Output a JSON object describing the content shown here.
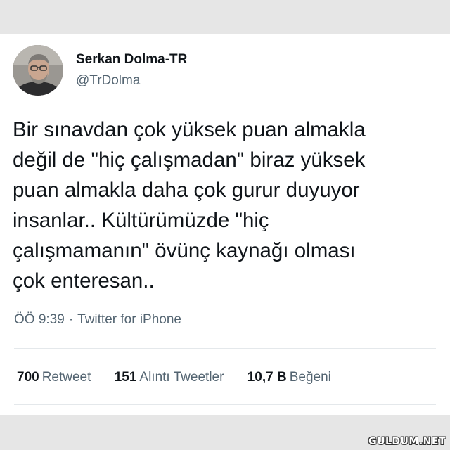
{
  "author": {
    "display_name": "Serkan Dolma-TR",
    "handle": "@TrDolma"
  },
  "tweet": {
    "lines": [
      "Bir sınavdan çok yüksek puan almakla",
      "değil de \"hiç çalışmadan\" biraz yüksek",
      "puan almakla daha çok gurur duyuyor",
      "insanlar.. Kültürümüzde \"hiç",
      "çalışmamanın\" övünç kaynağı olması",
      "çok enteresan.."
    ],
    "time": "ÖÖ 9:39",
    "separator": "·",
    "source": "Twitter for iPhone"
  },
  "stats": [
    {
      "value": "700",
      "label": "Retweet"
    },
    {
      "value": "151",
      "label": "Alıntı Tweetler"
    },
    {
      "value": "10,7 B",
      "label": "Beğeni"
    }
  ],
  "watermark": "GULDUM.NET",
  "colors": {
    "text": "#0f1419",
    "secondary": "#536471",
    "background": "#e6e6e6",
    "card": "#ffffff"
  }
}
